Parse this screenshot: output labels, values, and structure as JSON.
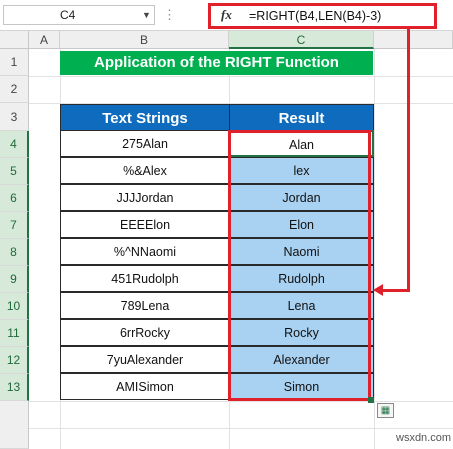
{
  "formula_bar": {
    "name_box": "C4",
    "fx_label": "fx",
    "formula": "=RIGHT(B4,LEN(B4)-3)",
    "dots": "⋮"
  },
  "columns": [
    "A",
    "B",
    "C"
  ],
  "rows": [
    "1",
    "2",
    "3",
    "4",
    "5",
    "6",
    "7",
    "8",
    "9",
    "10",
    "11",
    "12",
    "13"
  ],
  "title": "Application of the RIGHT Function",
  "table": {
    "headers": [
      "Text Strings",
      "Result"
    ],
    "rows": [
      [
        "275Alan",
        "Alan"
      ],
      [
        "%&Alex",
        "lex"
      ],
      [
        "JJJJordan",
        "Jordan"
      ],
      [
        "EEEElon",
        "Elon"
      ],
      [
        "%^NNaomi",
        "Naomi"
      ],
      [
        "451Rudolph",
        "Rudolph"
      ],
      [
        "789Lena",
        "Lena"
      ],
      [
        "6rrRocky",
        "Rocky"
      ],
      [
        "7yuAlexander",
        "Alexander"
      ],
      [
        "AMISimon",
        "Simon"
      ]
    ]
  },
  "watermark": "wsxdn.com",
  "colors": {
    "accent_red": "#e0202a",
    "title_green": "#00b050",
    "header_blue": "#0f6bbd",
    "result_fill": "#a9d1f1"
  }
}
